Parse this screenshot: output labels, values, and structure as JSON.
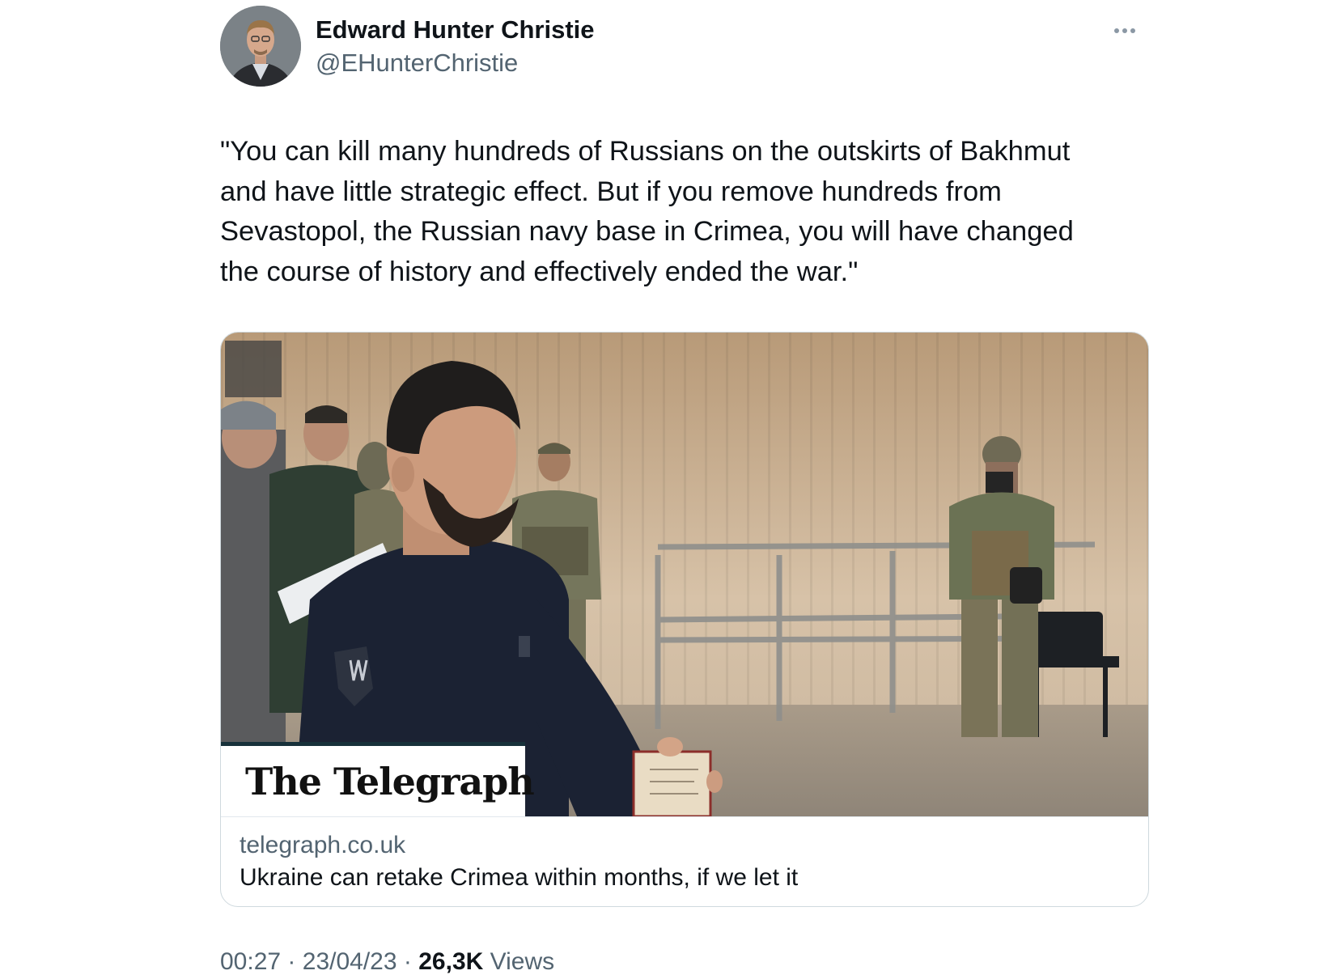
{
  "author": {
    "display_name": "Edward Hunter Christie",
    "handle": "@EHunterChristie"
  },
  "more_icon": "more-horizontal-icon",
  "tweet": {
    "text": "\"You can kill many hundreds of Russians on the outskirts of Bakhmut\nand have little strategic effect. But if you remove hundreds from\nSevastopol, the Russian navy base in Crimea, you will have changed\nthe course of history and effectively ended the war.\""
  },
  "card": {
    "publisher_logo": "The Telegraph",
    "domain": "telegraph.co.uk",
    "title": "Ukraine can retake Crimea within months, if we let it"
  },
  "meta": {
    "time": "00:27",
    "separator": "·",
    "date": "23/04/23",
    "views_count": "26,3K",
    "views_label": "Views"
  },
  "colors": {
    "text_primary": "#0f1419",
    "text_secondary": "#536471",
    "card_border": "#cfd9de"
  }
}
